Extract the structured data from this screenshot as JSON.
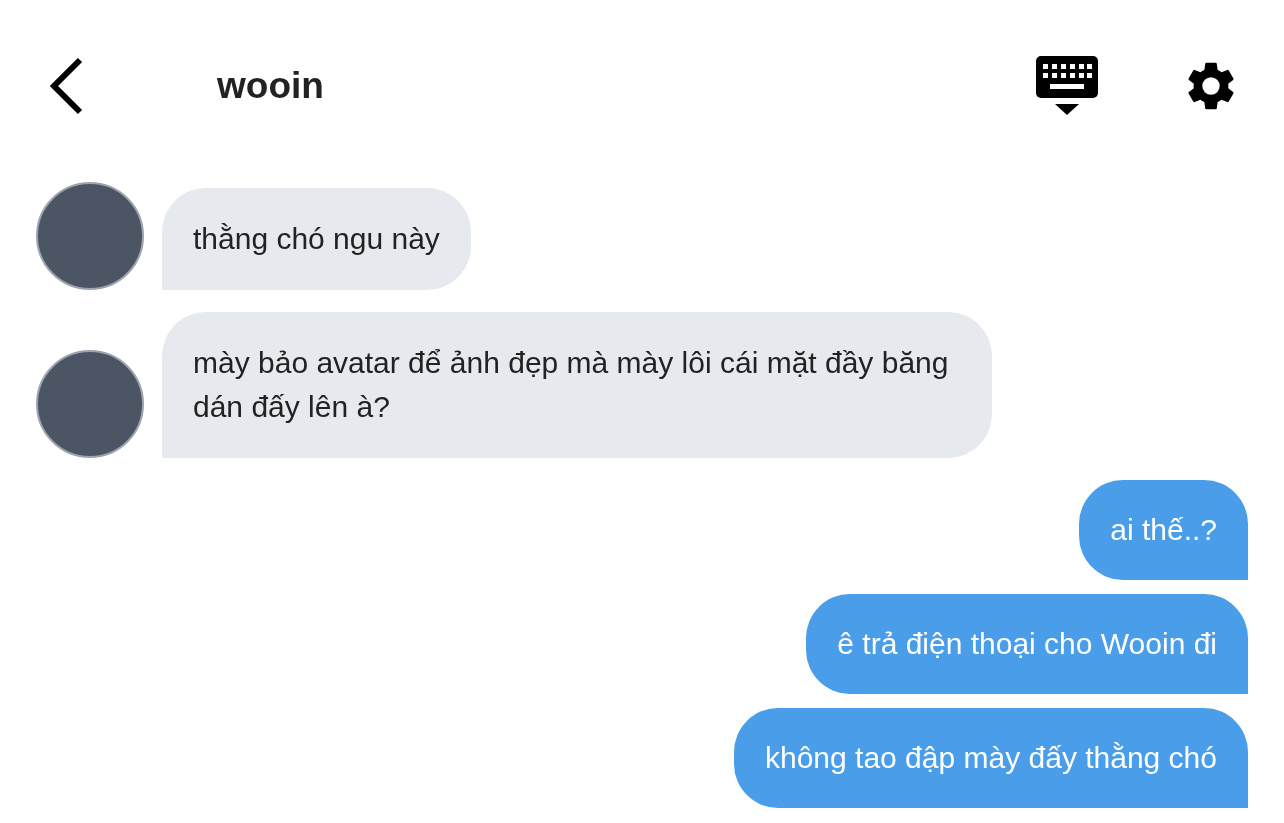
{
  "header": {
    "title": "wooin"
  },
  "messages": [
    {
      "kind": "incoming",
      "text": "thằng chó ngu này"
    },
    {
      "kind": "incoming",
      "text": "mày bảo avatar để ảnh đẹp mà mày lôi cái mặt đầy băng dán đấy lên à?"
    },
    {
      "kind": "outgoing",
      "text": "ai thế..?"
    },
    {
      "kind": "outgoing",
      "text": "ê trả điện thoại cho Wooin đi"
    },
    {
      "kind": "outgoing",
      "text": "không tao đập mày đấy thằng chó"
    }
  ]
}
